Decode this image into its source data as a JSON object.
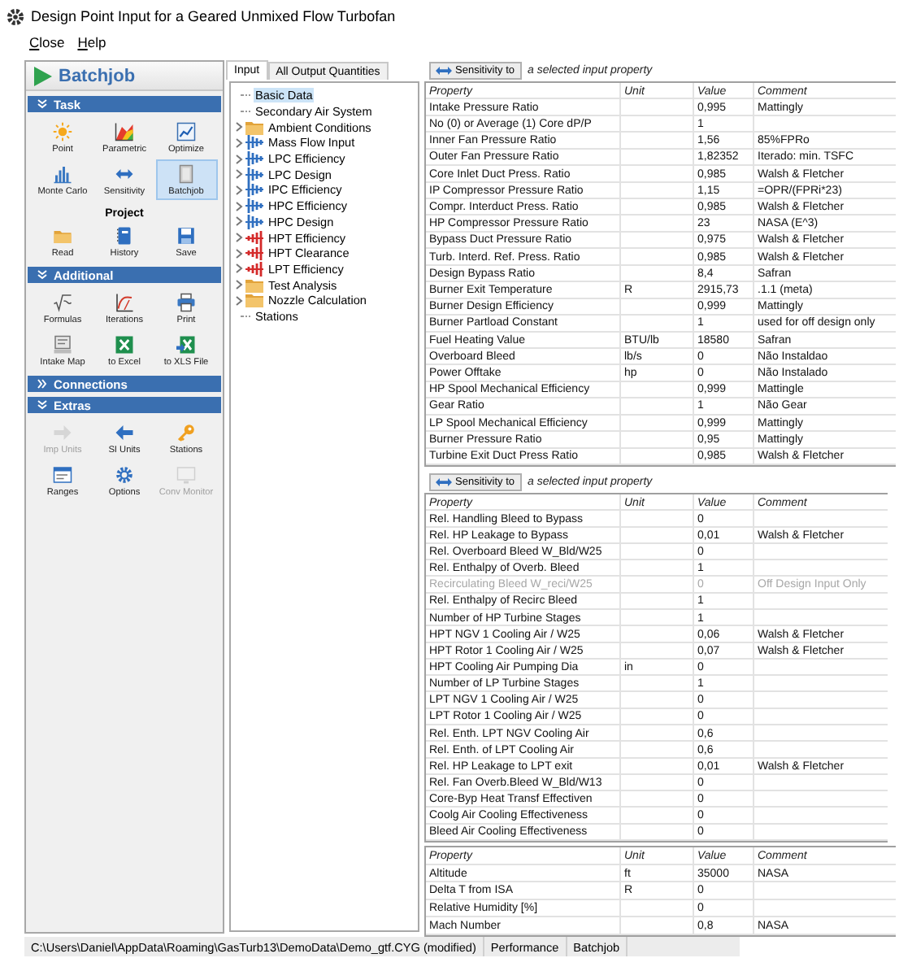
{
  "window": {
    "title": "Design Point Input for a Geared Unmixed Flow Turbofan"
  },
  "menu": [
    "Close",
    "Help"
  ],
  "sidebar": {
    "header": "Batchjob",
    "sections": [
      {
        "title": "Task",
        "expanded": true,
        "groups": [
          {
            "tools": [
              {
                "label": "Point",
                "selected": false,
                "disabled": false
              },
              {
                "label": "Parametric",
                "selected": false,
                "disabled": false
              },
              {
                "label": "Optimize",
                "selected": false,
                "disabled": false
              },
              {
                "label": "Monte Carlo",
                "selected": false,
                "disabled": false
              },
              {
                "label": "Sensitivity",
                "selected": false,
                "disabled": false
              },
              {
                "label": "Batchjob",
                "selected": true,
                "disabled": false
              }
            ]
          },
          {
            "heading": "Project",
            "tools": [
              {
                "label": "Read",
                "selected": false,
                "disabled": false
              },
              {
                "label": "History",
                "selected": false,
                "disabled": false
              },
              {
                "label": "Save",
                "selected": false,
                "disabled": false
              }
            ]
          }
        ]
      },
      {
        "title": "Additional",
        "expanded": true,
        "groups": [
          {
            "tools": [
              {
                "label": "Formulas",
                "selected": false,
                "disabled": false
              },
              {
                "label": "Iterations",
                "selected": false,
                "disabled": false
              },
              {
                "label": "Print",
                "selected": false,
                "disabled": false
              },
              {
                "label": "Intake Map",
                "selected": false,
                "disabled": false
              },
              {
                "label": "to Excel",
                "selected": false,
                "disabled": false
              },
              {
                "label": "to XLS File",
                "selected": false,
                "disabled": false
              }
            ]
          }
        ]
      },
      {
        "title": "Connections",
        "expanded": false
      },
      {
        "title": "Extras",
        "expanded": true,
        "groups": [
          {
            "tools": [
              {
                "label": "Imp Units",
                "selected": false,
                "disabled": true
              },
              {
                "label": "SI Units",
                "selected": false,
                "disabled": false
              },
              {
                "label": "Stations",
                "selected": false,
                "disabled": false
              },
              {
                "label": "Ranges",
                "selected": false,
                "disabled": false
              },
              {
                "label": "Options",
                "selected": false,
                "disabled": false
              },
              {
                "label": "Conv Monitor",
                "selected": false,
                "disabled": true
              }
            ]
          }
        ]
      }
    ]
  },
  "tabs": [
    {
      "label": "Input",
      "selected": true
    },
    {
      "label": "All Output Quantities",
      "selected": false
    }
  ],
  "tree": [
    {
      "label": "Basic Data",
      "kind": "leaf",
      "selected": true
    },
    {
      "label": "Secondary Air System",
      "kind": "leaf",
      "selected": false
    },
    {
      "label": "Ambient Conditions",
      "kind": "folder",
      "expanded": false,
      "selected": false
    },
    {
      "label": "Mass Flow Input",
      "kind": "compressor",
      "expanded": false,
      "selected": false
    },
    {
      "label": "LPC Efficiency",
      "kind": "compressor",
      "expanded": false,
      "selected": false
    },
    {
      "label": "LPC Design",
      "kind": "compressor",
      "expanded": false,
      "selected": false
    },
    {
      "label": "IPC Efficiency",
      "kind": "compressor",
      "expanded": false,
      "selected": false
    },
    {
      "label": "HPC Efficiency",
      "kind": "compressor",
      "expanded": false,
      "selected": false
    },
    {
      "label": "HPC Design",
      "kind": "compressor",
      "expanded": false,
      "selected": false
    },
    {
      "label": "HPT Efficiency",
      "kind": "turbine",
      "expanded": false,
      "selected": false
    },
    {
      "label": "HPT Clearance",
      "kind": "turbine",
      "expanded": false,
      "selected": false
    },
    {
      "label": "LPT Efficiency",
      "kind": "turbine",
      "expanded": false,
      "selected": false
    },
    {
      "label": "Test Analysis",
      "kind": "folder",
      "expanded": false,
      "selected": false
    },
    {
      "label": "Nozzle Calculation",
      "kind": "folder",
      "expanded": false,
      "selected": false
    },
    {
      "label": "Stations",
      "kind": "leaf",
      "selected": false
    }
  ],
  "tables": [
    {
      "toolbar": {
        "button": "Sensitivity to",
        "hint": "a selected input property"
      },
      "columns": [
        "Property",
        "Unit",
        "Value",
        "Comment"
      ],
      "rows": [
        {
          "property": "Intake Pressure Ratio",
          "value": "0,995",
          "comment": "Mattingly"
        },
        {
          "property": "No (0) or Average (1) Core dP/P",
          "value": "1"
        },
        {
          "property": "Inner Fan Pressure Ratio",
          "value": "1,56",
          "comment": "85%FPRo"
        },
        {
          "property": "Outer Fan Pressure Ratio",
          "value": "1,82352",
          "comment": "Iterado: min. TSFC"
        },
        {
          "property": "Core Inlet Duct Press. Ratio",
          "value": "0,985",
          "comment": "Walsh & Fletcher"
        },
        {
          "property": "IP Compressor Pressure Ratio",
          "value": "1,15",
          "comment": "=OPR/(FPRi*23)"
        },
        {
          "property": "Compr. Interduct Press. Ratio",
          "value": "0,985",
          "comment": "Walsh & Fletcher"
        },
        {
          "property": "HP Compressor Pressure Ratio",
          "value": "23",
          "comment": "NASA (E^3)"
        },
        {
          "property": "Bypass Duct Pressure Ratio",
          "value": "0,975",
          "comment": "Walsh & Fletcher"
        },
        {
          "property": "Turb. Interd. Ref. Press. Ratio",
          "value": "0,985",
          "comment": "Walsh & Fletcher"
        },
        {
          "property": "Design Bypass Ratio",
          "value": "8,4",
          "comment": "Safran"
        },
        {
          "property": "Burner Exit Temperature",
          "unit": "R",
          "value": "2915,73",
          "comment": ".1.1 (meta)"
        },
        {
          "property": "Burner Design Efficiency",
          "value": "0,999",
          "comment": "Mattingly"
        },
        {
          "property": "Burner Partload Constant",
          "value": "1",
          "comment": "used for off design only"
        },
        {
          "property": "Fuel Heating Value",
          "unit": "BTU/lb",
          "value": "18580",
          "comment": "Safran"
        },
        {
          "property": "Overboard Bleed",
          "unit": "lb/s",
          "value": "0",
          "comment": "Não Instaldao"
        },
        {
          "property": "Power Offtake",
          "unit": "hp",
          "value": "0",
          "comment": "Não Instalado"
        },
        {
          "property": "HP Spool Mechanical Efficiency",
          "value": "0,999",
          "comment": "Mattingle"
        },
        {
          "property": "Gear Ratio",
          "value": "1",
          "comment": "Não Gear"
        },
        {
          "property": "LP Spool Mechanical Efficiency",
          "value": "0,999",
          "comment": "Mattingly"
        },
        {
          "property": "Burner Pressure Ratio",
          "value": "0,95",
          "comment": "Mattingly"
        },
        {
          "property": "Turbine Exit Duct Press Ratio",
          "value": "0,985",
          "comment": "Walsh & Fletcher"
        }
      ]
    },
    {
      "toolbar": {
        "button": "Sensitivity to",
        "hint": "a selected input property"
      },
      "columns": [
        "Property",
        "Unit",
        "Value",
        "Comment"
      ],
      "rows": [
        {
          "property": "Rel. Handling Bleed to Bypass",
          "value": "0",
          "disabled": false
        },
        {
          "property": "Rel. HP Leakage to Bypass",
          "value": "0,01",
          "comment": "Walsh & Fletcher",
          "disabled": false
        },
        {
          "property": "Rel. Overboard Bleed W_Bld/W25",
          "value": "0",
          "disabled": false
        },
        {
          "property": "Rel. Enthalpy of Overb. Bleed",
          "value": "1",
          "disabled": false
        },
        {
          "property": "Recirculating Bleed W_reci/W25",
          "value": "0",
          "comment": "Off Design Input Only",
          "disabled": true
        },
        {
          "property": "Rel. Enthalpy of Recirc Bleed",
          "value": "1",
          "disabled": false
        },
        {
          "property": "Number of HP Turbine Stages",
          "value": "1",
          "disabled": false
        },
        {
          "property": "HPT NGV 1 Cooling Air / W25",
          "value": "0,06",
          "comment": "Walsh & Fletcher",
          "disabled": false
        },
        {
          "property": "HPT Rotor 1 Cooling Air / W25",
          "value": "0,07",
          "comment": "Walsh & Fletcher",
          "disabled": false
        },
        {
          "property": "HPT Cooling Air Pumping Dia",
          "unit": "in",
          "value": "0",
          "disabled": false
        },
        {
          "property": "Number of LP Turbine Stages",
          "value": "1",
          "disabled": false
        },
        {
          "property": "LPT NGV 1 Cooling Air / W25",
          "value": "0",
          "disabled": false
        },
        {
          "property": "LPT Rotor 1 Cooling Air / W25",
          "value": "0",
          "disabled": false
        },
        {
          "property": "Rel. Enth. LPT NGV Cooling Air",
          "value": "0,6",
          "disabled": false
        },
        {
          "property": "Rel. Enth. of LPT Cooling Air",
          "value": "0,6",
          "disabled": false
        },
        {
          "property": "Rel. HP Leakage to LPT exit",
          "value": "0,01",
          "comment": "Walsh & Fletcher",
          "disabled": false
        },
        {
          "property": "Rel. Fan Overb.Bleed W_Bld/W13",
          "value": "0",
          "disabled": false
        },
        {
          "property": "Core-Byp Heat Transf Effectiven",
          "value": "0",
          "disabled": false
        },
        {
          "property": "Coolg Air Cooling Effectiveness",
          "value": "0",
          "disabled": false
        },
        {
          "property": "Bleed Air Cooling Effectiveness",
          "value": "0",
          "disabled": false
        }
      ]
    },
    {
      "columns": [
        "Property",
        "Unit",
        "Value",
        "Comment"
      ],
      "rows": [
        {
          "property": "Altitude",
          "unit": "ft",
          "value": "35000",
          "comment": "NASA"
        },
        {
          "property": "Delta T from ISA",
          "unit": "R",
          "value": "0"
        },
        {
          "property": "Relative Humidity [%]",
          "value": "0"
        },
        {
          "property": "Mach Number",
          "value": "0,8",
          "comment": "NASA"
        }
      ]
    }
  ],
  "status_bar": [
    "C:\\Users\\Daniel\\AppData\\Roaming\\GasTurb13\\DemoData\\Demo_gtf.CYG  (modified)",
    "Performance",
    "Batchjob"
  ]
}
